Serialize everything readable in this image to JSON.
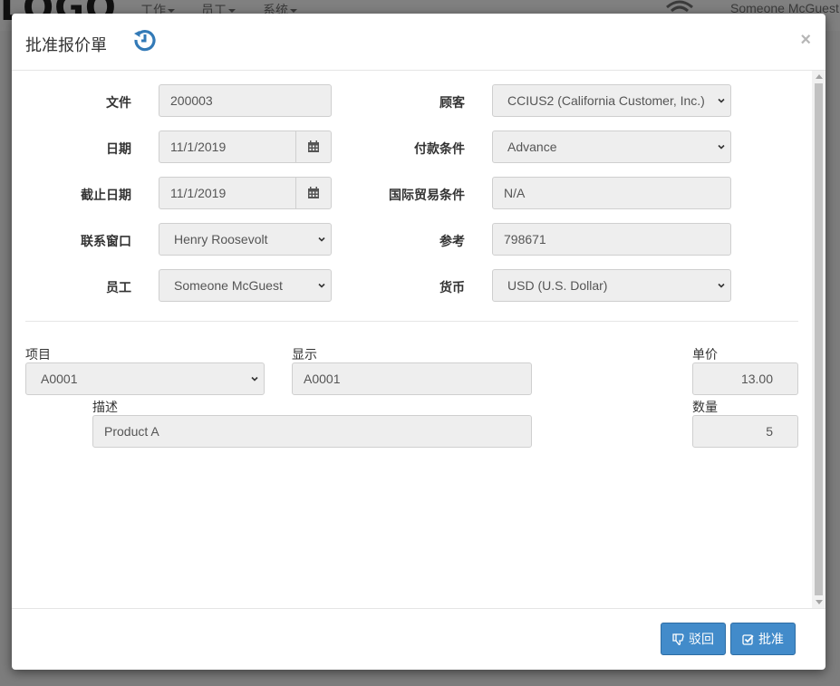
{
  "app": {
    "logo_text": "LOGO",
    "nav": [
      {
        "label": "工作"
      },
      {
        "label": "员工"
      },
      {
        "label": "系统"
      }
    ],
    "user": "Someone McGuest"
  },
  "modal": {
    "title": "批准报价單",
    "close": "×"
  },
  "form": {
    "document": {
      "label": "文件",
      "value": "200003"
    },
    "date": {
      "label": "日期",
      "value": "11/1/2019"
    },
    "due_date": {
      "label": "截止日期",
      "value": "11/1/2019"
    },
    "contact": {
      "label": "联系窗口",
      "value": "Henry Roosevolt"
    },
    "employee": {
      "label": "员工",
      "value": "Someone McGuest"
    },
    "customer": {
      "label": "顾客",
      "value": "CCIUS2 (California Customer, Inc.)"
    },
    "payment_terms": {
      "label": "付款条件",
      "value": "Advance"
    },
    "incoterms": {
      "label": "国际贸易条件",
      "value": "N/A"
    },
    "reference": {
      "label": "参考",
      "value": "798671"
    },
    "currency": {
      "label": "货币",
      "value": "USD (U.S. Dollar)"
    }
  },
  "line": {
    "item": {
      "label": "项目",
      "value": "A0001"
    },
    "display": {
      "label": "显示",
      "value": "A0001"
    },
    "unit_price": {
      "label": "单价",
      "value": "13.00"
    },
    "description": {
      "label": "描述",
      "value": "Product A"
    },
    "quantity": {
      "label": "数量",
      "value": "5"
    }
  },
  "footer": {
    "reject": "驳回",
    "approve": "批准"
  },
  "colors": {
    "primary": "#428bca",
    "history_icon": "#337ab7"
  }
}
